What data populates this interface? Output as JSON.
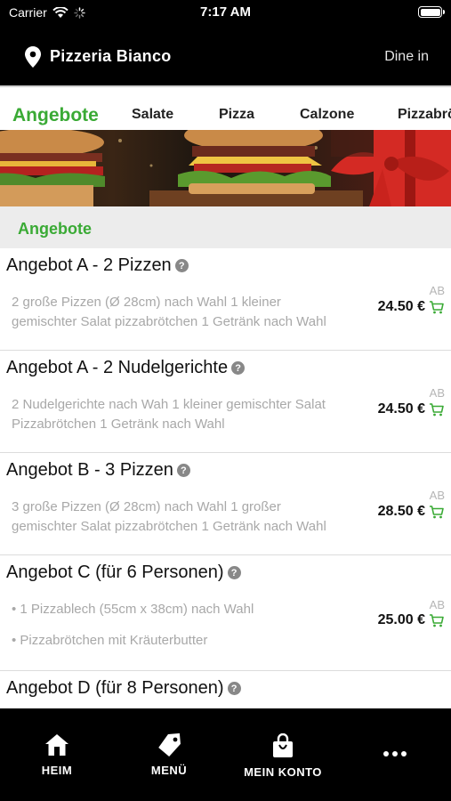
{
  "status_bar": {
    "carrier": "Carrier",
    "time": "7:17 AM"
  },
  "header": {
    "restaurant_name": "Pizzeria Bianco",
    "dine_mode": "Dine in"
  },
  "tabs": [
    {
      "label": "Angebote",
      "active": true
    },
    {
      "label": "Salate",
      "active": false
    },
    {
      "label": "Pizza",
      "active": false
    },
    {
      "label": "Calzone",
      "active": false
    },
    {
      "label": "Pizzabrötchen",
      "active": false
    }
  ],
  "section": {
    "title": "Angebote"
  },
  "items": [
    {
      "title": "Angebot A - 2 Pizzen",
      "description": [
        "2 große Pizzen (Ø 28cm) nach Wahl 1 kleiner gemischter Salat pizzabrötchen 1 Getränk nach Wahl"
      ],
      "ab": "AB",
      "price": "24.50 €"
    },
    {
      "title": "Angebot A - 2 Nudelgerichte",
      "description": [
        "2 Nudelgerichte nach Wah 1 kleiner gemischter Salat Pizzabrötchen 1 Getränk nach Wahl"
      ],
      "ab": "AB",
      "price": "24.50 €"
    },
    {
      "title": "Angebot B - 3 Pizzen",
      "description": [
        "3 große Pizzen (Ø 28cm) nach Wahl 1 großer gemischter Salat pizzabrötchen 1 Getränk nach Wahl"
      ],
      "ab": "AB",
      "price": "28.50 €"
    },
    {
      "title": "Angebot C (für 6 Personen)",
      "description": [
        "• 1 Pizzablech (55cm x 38cm) nach Wahl",
        "• Pizzabrötchen mit Kräuterbutter"
      ],
      "ab": "AB",
      "price": "25.00 €"
    },
    {
      "title": "Angebot D (für 8 Personen)",
      "description": [],
      "ab": "",
      "price": ""
    }
  ],
  "bottom_nav": [
    {
      "label": "HEIM",
      "icon": "home-icon"
    },
    {
      "label": "MENÜ",
      "icon": "tag-icon"
    },
    {
      "label": "MEIN KONTO",
      "icon": "bag-icon"
    },
    {
      "label": "",
      "icon": "more-icon"
    }
  ],
  "colors": {
    "accent": "#3aaa35",
    "header_bg": "#000000",
    "section_bg": "#ececec"
  }
}
